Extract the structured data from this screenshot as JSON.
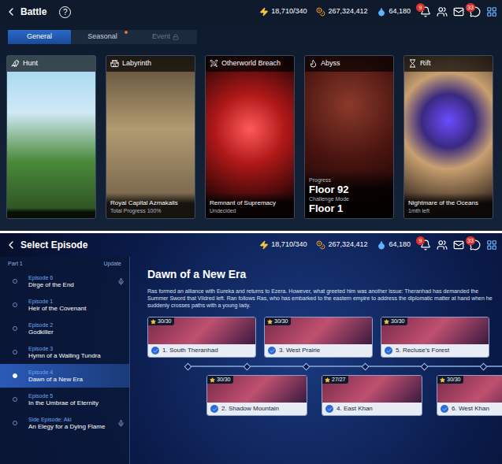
{
  "battle": {
    "title": "Battle",
    "help": "?",
    "currencies": [
      {
        "kind": "stamina",
        "value": "18,710/340"
      },
      {
        "kind": "gold",
        "value": "267,324,412"
      },
      {
        "kind": "crystal",
        "value": "64,180"
      }
    ],
    "notifications": {
      "bell_badge": "9",
      "chat_badge": "33"
    },
    "tabs": [
      {
        "label": "General",
        "selected": true,
        "dot": false,
        "locked": false
      },
      {
        "label": "Seasonal",
        "selected": false,
        "dot": true,
        "locked": false
      },
      {
        "label": "Event",
        "selected": false,
        "dot": false,
        "locked": true
      }
    ],
    "cards": [
      {
        "name": "Hunt",
        "lines": []
      },
      {
        "name": "Labyrinth",
        "lines": [
          {
            "kind": "value",
            "text": "Royal Capital Azmakalis"
          },
          {
            "kind": "label",
            "text": "Total Progress 100%"
          }
        ]
      },
      {
        "name": "Otherworld Breach",
        "lines": [
          {
            "kind": "value",
            "text": "Remnant of Supremacy"
          },
          {
            "kind": "label",
            "text": "Undecided"
          }
        ]
      },
      {
        "name": "Abyss",
        "lines": [
          {
            "kind": "label",
            "text": "Progress"
          },
          {
            "kind": "big",
            "text": "Floor 92"
          },
          {
            "kind": "label",
            "text": "Challenge Mode"
          },
          {
            "kind": "big",
            "text": "Floor 1"
          }
        ]
      },
      {
        "name": "Rift",
        "lines": [
          {
            "kind": "value",
            "text": "Nightmare of the Oceans"
          },
          {
            "kind": "label",
            "text": "1mth left"
          }
        ]
      }
    ]
  },
  "episodes": {
    "title": "Select Episode",
    "currencies": [
      {
        "kind": "stamina",
        "value": "18,710/340"
      },
      {
        "kind": "gold",
        "value": "267,324,412"
      },
      {
        "kind": "crystal",
        "value": "64,180"
      }
    ],
    "notifications": {
      "bell_badge": "9",
      "chat_badge": "33"
    },
    "part": "Part 1",
    "update": "Update",
    "list": [
      {
        "label": "Episode 6",
        "title": "Dirge of the End",
        "selected": false,
        "audio": true
      },
      {
        "label": "Episode 1",
        "title": "Heir of the Covenant",
        "selected": false,
        "audio": false
      },
      {
        "label": "Episode 2",
        "title": "Godkiller",
        "selected": false,
        "audio": false
      },
      {
        "label": "Episode 3",
        "title": "Hymn of a Wailing Tundra",
        "selected": false,
        "audio": false
      },
      {
        "label": "Episode 4",
        "title": "Dawn of a New Era",
        "selected": true,
        "audio": false
      },
      {
        "label": "Episode 5",
        "title": "In the Umbrae of Eternity",
        "selected": false,
        "audio": false
      },
      {
        "label": "Side Episode: Aki",
        "title": "An Elegy for a Dying Flame",
        "selected": false,
        "audio": true
      }
    ],
    "detail": {
      "title": "Dawn of a New Era",
      "description": "Ras formed an alliance with Eureka and returns to Ezera. However, what greeted him was another issue: Theranhad has demanded the Summer Sword that Vildred left. Ran follows Ras, who has embarked to the eastern empire to address the diplomatic matter at hand when he suddenly crosses paths with a young lady."
    },
    "stages": [
      {
        "name": "1. South Theranhad",
        "stars": "30/30",
        "cleared": true
      },
      {
        "name": "2. Shadow Mountain",
        "stars": "30/30",
        "cleared": true
      },
      {
        "name": "3. West Prairie",
        "stars": "30/30",
        "cleared": true
      },
      {
        "name": "4. East Khan",
        "stars": "27/27",
        "cleared": true
      },
      {
        "name": "5. Recluse's Forest",
        "stars": "30/30",
        "cleared": true
      },
      {
        "name": "6. West Khan",
        "stars": "30/30",
        "cleared": true
      }
    ]
  }
}
